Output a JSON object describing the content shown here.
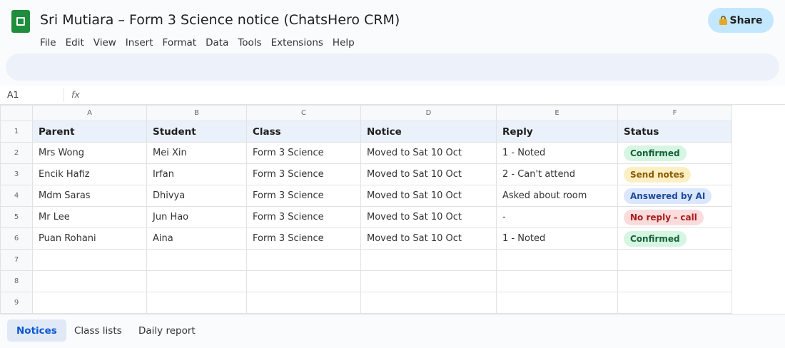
{
  "app": {
    "title": "Sri Mutiara – Form 3 Science notice (ChatsHero CRM)",
    "logo_icon": "sheets-logo-icon",
    "share_label": "Share",
    "share_icon": "lock-icon",
    "accent_color": "#c2e7ff"
  },
  "menu": [
    "File",
    "Edit",
    "View",
    "Insert",
    "Format",
    "Data",
    "Tools",
    "Extensions",
    "Help"
  ],
  "formula_bar": {
    "cell_ref": "A1",
    "fx_label": "fx",
    "value": ""
  },
  "sheet": {
    "column_letters": [
      "A",
      "B",
      "C",
      "D",
      "E",
      "F"
    ],
    "row_numbers": [
      "1",
      "2",
      "3",
      "4",
      "5",
      "6",
      "7",
      "8",
      "9"
    ],
    "headers": [
      "Parent",
      "Student",
      "Class",
      "Notice",
      "Reply",
      "Status"
    ],
    "rows": [
      [
        "Mrs Wong",
        "Mei Xin",
        "Form 3 Science",
        "Moved to Sat 10 Oct",
        "1 - Noted",
        "Confirmed"
      ],
      [
        "Encik Hafiz",
        "Irfan",
        "Form 3 Science",
        "Moved to Sat 10 Oct",
        "2 - Can't attend",
        "Send notes"
      ],
      [
        "Mdm Saras",
        "Dhivya",
        "Form 3 Science",
        "Moved to Sat 10 Oct",
        "Asked about room",
        "Answered by AI"
      ],
      [
        "Mr Lee",
        "Jun Hao",
        "Form 3 Science",
        "Moved to Sat 10 Oct",
        "-",
        "No reply - call"
      ],
      [
        "Puan Rohani",
        "Aina",
        "Form 3 Science",
        "Moved to Sat 10 Oct",
        "1 - Noted",
        "Confirmed"
      ]
    ],
    "status_colors": {
      "Confirmed": "#17643a",
      "Send notes": "#8a5a00",
      "Answered by AI": "#1d4a9c",
      "No reply - call": "#a81c1c"
    }
  },
  "tabs": [
    "Notices",
    "Class lists",
    "Daily report"
  ],
  "active_tab": "Notices"
}
